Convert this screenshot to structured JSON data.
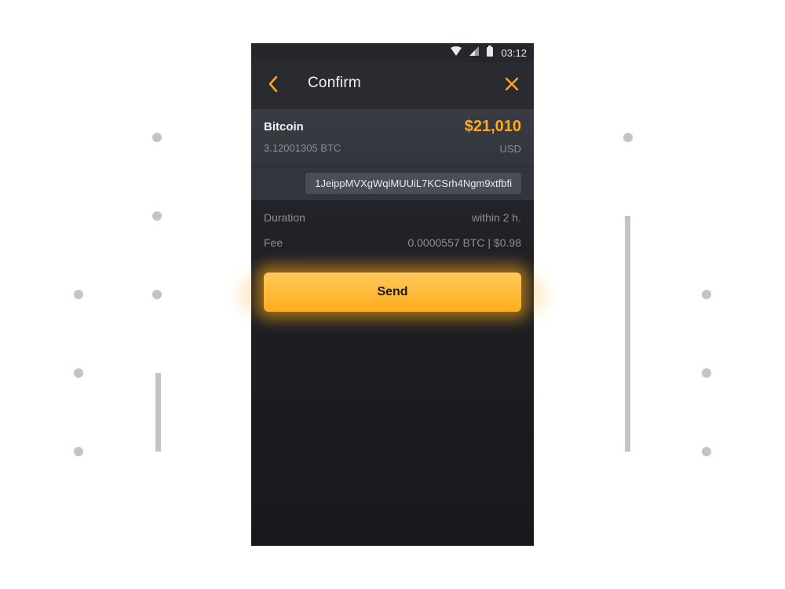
{
  "status_bar": {
    "time": "03:12",
    "icons": [
      "wifi-icon",
      "signal-icon",
      "battery-icon"
    ]
  },
  "header": {
    "title": "Confirm",
    "back_icon": "chevron-left-icon",
    "close_icon": "close-icon"
  },
  "asset": {
    "name": "Bitcoin",
    "amount": "3.12001305 BTC",
    "fiat_value": "$21,010",
    "fiat_currency": "USD",
    "address": "1JeippMVXgWqiMUUiL7KCSrh4Ngm9xtfbfi"
  },
  "details": {
    "duration_label": "Duration",
    "duration_value": "within 2 h.",
    "fee_label": "Fee",
    "fee_value": "0.0000557 BTC | $0.98"
  },
  "send_label": "Send",
  "colors": {
    "accent": "#ffa91f",
    "background": "#1f2025"
  }
}
